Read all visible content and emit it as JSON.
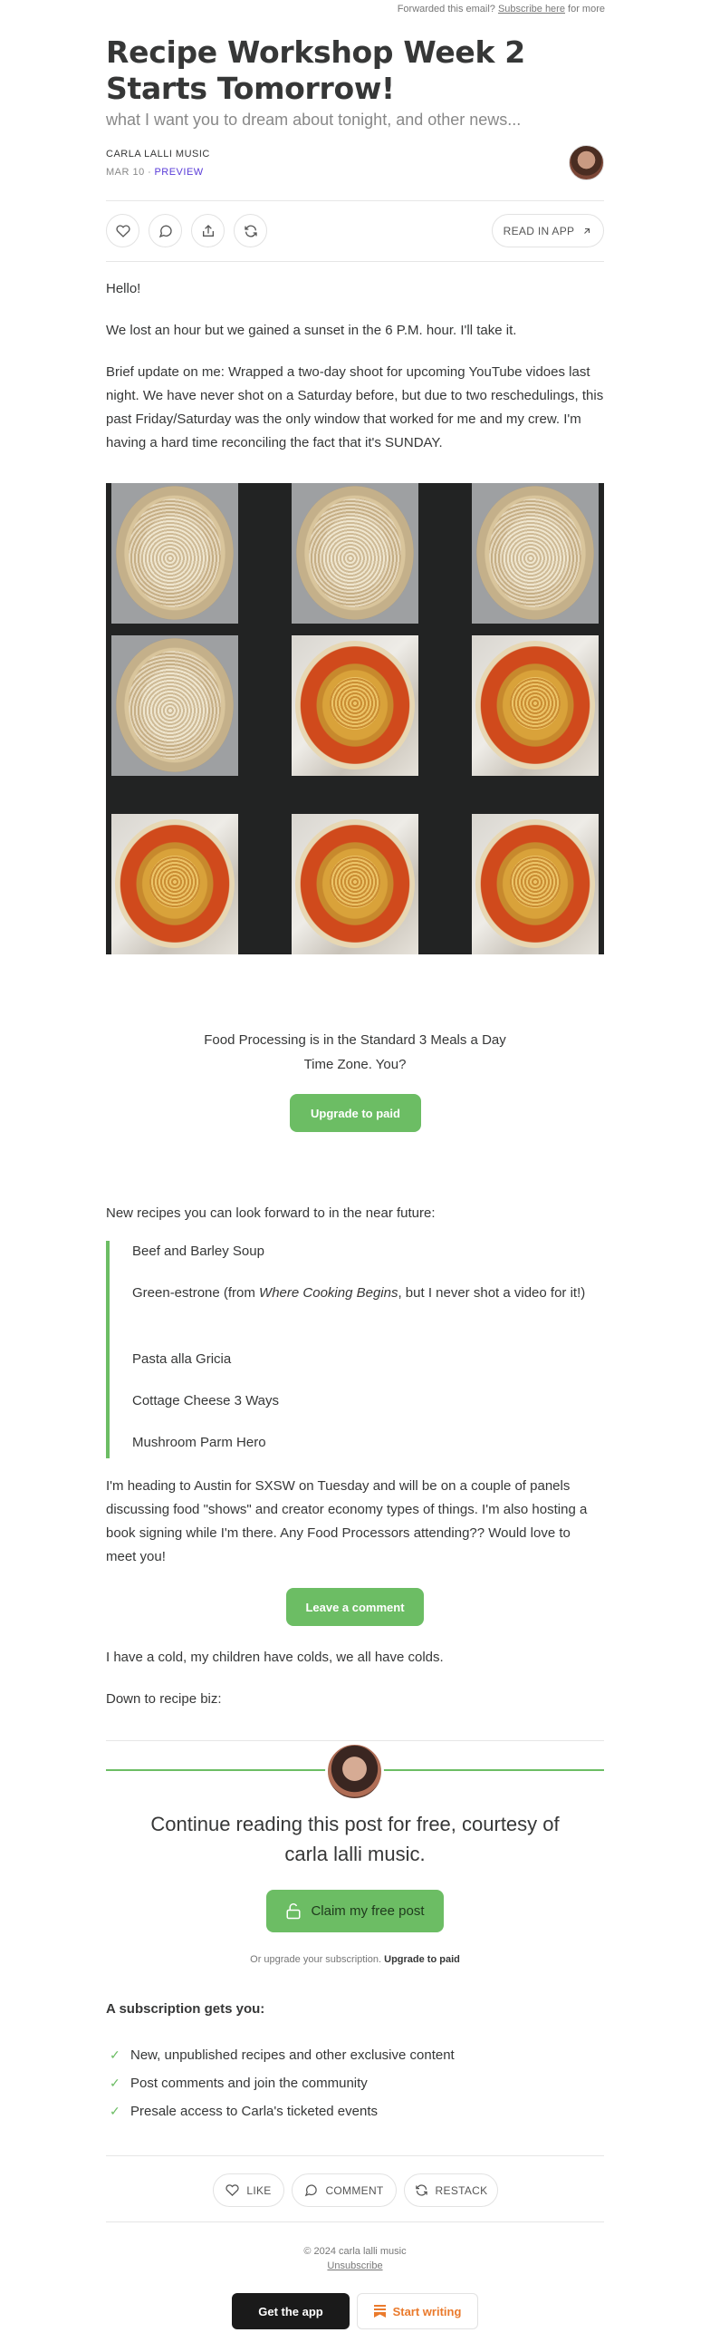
{
  "forwarded": {
    "prefix": "Forwarded this email?",
    "link": "Subscribe here",
    "suffix": "for more"
  },
  "post": {
    "title": "Recipe Workshop Week 2 Starts Tomorrow!",
    "subtitle": "what I want you to dream about tonight, and other news...",
    "author": "CARLA LALLI MUSIC",
    "date": "MAR 10",
    "separator": "∙",
    "preview_label": "PREVIEW"
  },
  "actions": {
    "like_icon": "heart-icon",
    "comment_icon": "comment-icon",
    "share_icon": "share-icon",
    "restack_icon": "restack-icon",
    "read_in_app": "READ IN APP"
  },
  "body": {
    "greeting": "Hello!",
    "p1": "We lost an hour but we gained a sunset in the 6 P.M. hour. I'll take it.",
    "p2": "Brief update on me: Wrapped a two-day shoot for upcoming YouTube vidoes last night. We have never shot on a Saturday before, but due to two reschedulings, this past Friday/Saturday was the only window that worked for me and my crew. I'm having a hard time reconciling the fact that it's SUNDAY.",
    "promo_line1": "Food Processing is in the Standard 3 Meals a Day",
    "promo_line2": "Time Zone. You?",
    "upgrade_button": "Upgrade to paid",
    "recipes_intro": "New recipes you can look forward to in the near future:",
    "recipes": [
      "Beef and Barley Soup",
      "Green-estrone (from ",
      "Pasta alla Gricia",
      "Cottage Cheese 3 Ways",
      "Mushroom Parm Hero"
    ],
    "recipe2_book": "Where Cooking Begins",
    "recipe2_rest": ", but I never shot a video for it!)",
    "p3": "I'm heading to Austin for SXSW on Tuesday and will be on a couple of panels discussing food \"shows\" and creator economy types of things. I'm also hosting a book signing while I'm there. Any Food Processors attending?? Would love to meet you!",
    "comment_button": "Leave a comment",
    "p4": "I have a cold, my children have colds, we all have colds.",
    "p5": "Down to recipe biz:"
  },
  "paywall": {
    "heading_line1": "Continue reading this post for free, courtesy of",
    "heading_line2": "carla lalli music.",
    "claim_button": "Claim my free post",
    "or_text": "Or upgrade your subscription.",
    "or_link": "Upgrade to paid",
    "subs_heading": "A subscription gets you:",
    "benefits": [
      "New, unpublished recipes and other exclusive content",
      "Post comments and join the community",
      "Presale access to Carla's ticketed events"
    ]
  },
  "footer_actions": {
    "like": "LIKE",
    "comment": "COMMENT",
    "restack": "RESTACK"
  },
  "footer": {
    "copyright": "© 2024 carla lalli music",
    "unsubscribe": "Unsubscribe",
    "get_app": "Get the app",
    "start_writing": "Start writing"
  },
  "colors": {
    "accent_green": "#6cbd64",
    "preview_purple": "#5a3cd8",
    "start_orange": "#ea7a2c"
  }
}
